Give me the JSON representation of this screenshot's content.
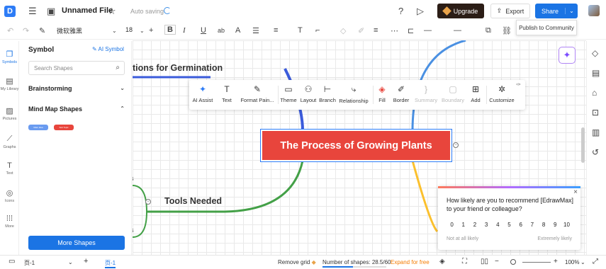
{
  "app": {
    "file_name": "Unnamed File",
    "autosave": "Auto saving",
    "upgrade": "Upgrade",
    "export": "Export",
    "share": "Share",
    "share_tooltip": "Publish to Community"
  },
  "toolbar": {
    "font": "微软雅黑",
    "size": "18"
  },
  "leftrail": [
    {
      "label": "Symbols",
      "icon": "symbols-icon"
    },
    {
      "label": "My Library",
      "icon": "library-icon"
    },
    {
      "label": "Pictures",
      "icon": "picture-icon"
    },
    {
      "label": "Graphs",
      "icon": "graph-icon"
    },
    {
      "label": "Text",
      "icon": "text-icon"
    },
    {
      "label": "Icons",
      "icon": "icons-icon"
    },
    {
      "label": "More",
      "icon": "more-grid-icon"
    }
  ],
  "panel": {
    "title": "Symbol",
    "ai_symbol": "AI Symbol",
    "search_placeholder": "Search Shapes",
    "sections": [
      "Brainstorming",
      "Mind Map Shapes"
    ],
    "shape_pills": [
      "Main Idea",
      "Sub Topic"
    ],
    "more_shapes": "More Shapes"
  },
  "canvas": {
    "central_topic": "The Process of Growing Plants",
    "branch_top_left": "tions for Germination",
    "branch_tools": "Tools Needed",
    "leaf_s1": "s",
    "leaf_s2": "s",
    "colors": {
      "central": "#e8453c",
      "blue": "#3b5bdb",
      "green": "#43a047",
      "yellow": "#fbc02d",
      "lightblue": "#4a90e2"
    }
  },
  "context_menu": [
    {
      "label": "AI Assist",
      "icon": "ai-assist-icon",
      "enabled": true
    },
    {
      "label": "Text",
      "icon": "text-icon",
      "enabled": true
    },
    {
      "label": "Format Pain...",
      "icon": "format-painter-icon",
      "enabled": true
    },
    {
      "label": "Theme",
      "icon": "theme-icon",
      "enabled": true
    },
    {
      "label": "Layout",
      "icon": "layout-icon",
      "enabled": true
    },
    {
      "label": "Branch",
      "icon": "branch-icon",
      "enabled": true
    },
    {
      "label": "Relationship",
      "icon": "relationship-icon",
      "enabled": true
    },
    {
      "label": "Fill",
      "icon": "fill-icon",
      "enabled": true
    },
    {
      "label": "Border",
      "icon": "border-icon",
      "enabled": true
    },
    {
      "label": "Summary",
      "icon": "summary-icon",
      "enabled": false
    },
    {
      "label": "Boundary",
      "icon": "boundary-icon",
      "enabled": false
    },
    {
      "label": "Add",
      "icon": "add-icon",
      "enabled": true
    },
    {
      "label": "Customize",
      "icon": "customize-icon",
      "enabled": true
    }
  ],
  "survey": {
    "question": "How likely are you to recommend [EdrawMax] to your friend or colleague?",
    "scale": [
      "0",
      "1",
      "2",
      "3",
      "4",
      "5",
      "6",
      "7",
      "8",
      "9",
      "10"
    ],
    "low": "Not at all likely",
    "high": "Extremely likely"
  },
  "statusbar": {
    "page_selector": "页-1",
    "page_tab": "页-1",
    "remove_grid": "Remove grid",
    "shapes_count": "Number of shapes: 28.5/60",
    "shapes_fraction": 0.475,
    "expand": "Expand for free",
    "zoom": "100%"
  }
}
